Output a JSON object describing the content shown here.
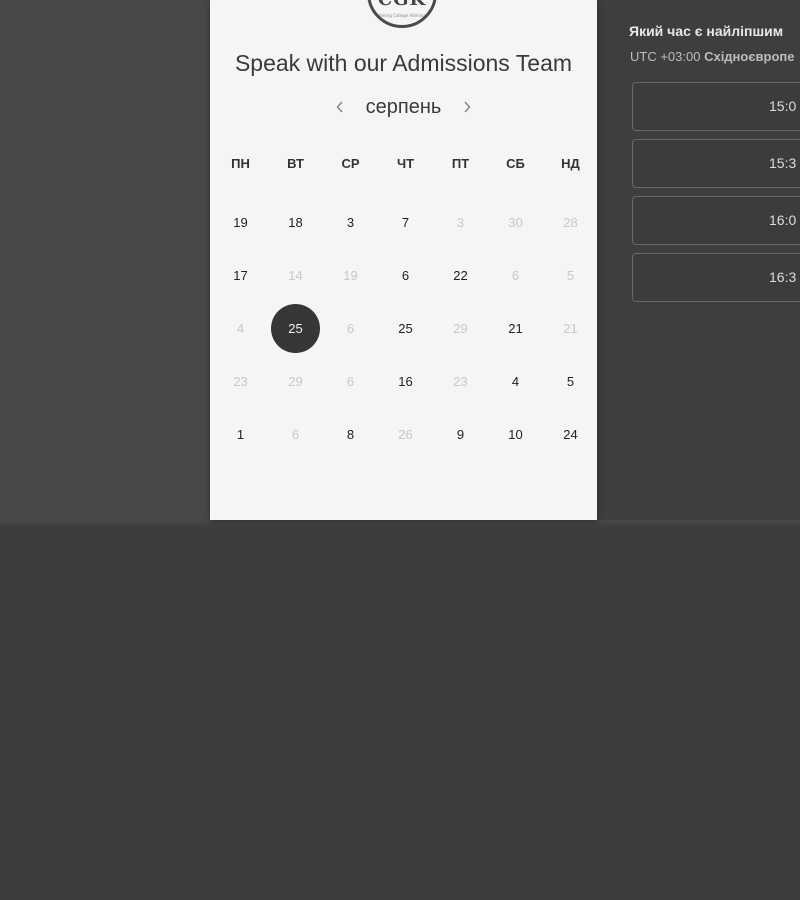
{
  "colors": {
    "panel": "#f5f5f5",
    "background": "#3c3c3c",
    "selected_day": "#363636",
    "text_dark": "#333333",
    "text_dim": "#c8c8c8"
  },
  "logo": {
    "mark": "CGK",
    "tagline": "Mastering College Admissions"
  },
  "calendar": {
    "title": "Speak with our Admissions Team",
    "month": "серпень",
    "prev_icon": "chevron-left-icon",
    "next_icon": "chevron-right-icon",
    "weekdays": [
      "ПН",
      "ВТ",
      "СР",
      "ЧТ",
      "ПТ",
      "СБ",
      "НД"
    ],
    "weeks": [
      [
        {
          "d": "19",
          "s": "avail"
        },
        {
          "d": "18",
          "s": "avail"
        },
        {
          "d": "3",
          "s": "avail"
        },
        {
          "d": "7",
          "s": "avail"
        },
        {
          "d": "3",
          "s": "dim"
        },
        {
          "d": "30",
          "s": "dim"
        },
        {
          "d": "28",
          "s": "dim"
        }
      ],
      [
        {
          "d": "17",
          "s": "avail"
        },
        {
          "d": "14",
          "s": "dim"
        },
        {
          "d": "19",
          "s": "dim"
        },
        {
          "d": "6",
          "s": "avail"
        },
        {
          "d": "22",
          "s": "avail"
        },
        {
          "d": "6",
          "s": "dim"
        },
        {
          "d": "5",
          "s": "dim"
        }
      ],
      [
        {
          "d": "4",
          "s": "dim"
        },
        {
          "d": "25",
          "s": "selected"
        },
        {
          "d": "6",
          "s": "dim"
        },
        {
          "d": "25",
          "s": "avail"
        },
        {
          "d": "29",
          "s": "dim"
        },
        {
          "d": "21",
          "s": "avail"
        },
        {
          "d": "21",
          "s": "dim"
        }
      ],
      [
        {
          "d": "23",
          "s": "dim"
        },
        {
          "d": "29",
          "s": "dim"
        },
        {
          "d": "6",
          "s": "dim"
        },
        {
          "d": "16",
          "s": "avail"
        },
        {
          "d": "23",
          "s": "dim"
        },
        {
          "d": "4",
          "s": "avail"
        },
        {
          "d": "5",
          "s": "avail"
        }
      ],
      [
        {
          "d": "1",
          "s": "avail"
        },
        {
          "d": "6",
          "s": "dim"
        },
        {
          "d": "8",
          "s": "avail"
        },
        {
          "d": "26",
          "s": "dim"
        },
        {
          "d": "9",
          "s": "avail"
        },
        {
          "d": "10",
          "s": "avail"
        },
        {
          "d": "24",
          "s": "avail"
        }
      ]
    ]
  },
  "slots": {
    "title": "Який час є найліпшим",
    "timezone_offset": "UTC +03:00",
    "timezone_name": "Східноєвропе",
    "times": [
      "15:0",
      "15:3",
      "16:0",
      "16:3"
    ]
  }
}
